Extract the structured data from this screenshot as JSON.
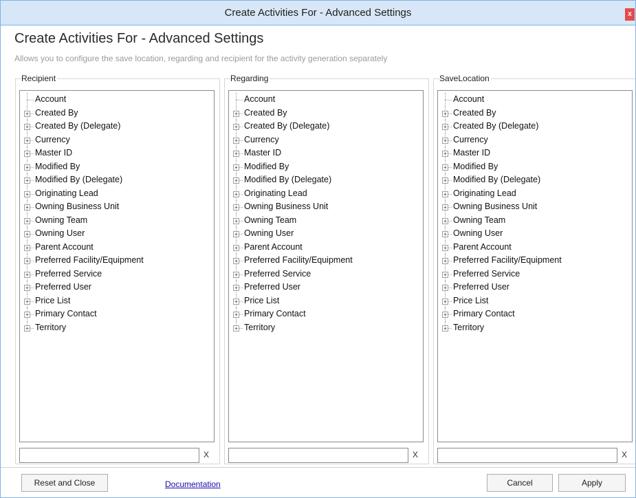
{
  "window": {
    "title": "Create Activities For - Advanced Settings",
    "close_label": "x"
  },
  "header": {
    "heading": "Create Activities For - Advanced Settings",
    "subheading": "Allows you to configure the save location, regarding and recipient for the activity generation separately"
  },
  "panels": [
    {
      "label": "Recipient",
      "items": [
        {
          "label": "Account",
          "expandable": false
        },
        {
          "label": "Created By",
          "expandable": true
        },
        {
          "label": "Created By (Delegate)",
          "expandable": true
        },
        {
          "label": "Currency",
          "expandable": true
        },
        {
          "label": "Master ID",
          "expandable": true
        },
        {
          "label": "Modified By",
          "expandable": true
        },
        {
          "label": "Modified By (Delegate)",
          "expandable": true
        },
        {
          "label": "Originating Lead",
          "expandable": true
        },
        {
          "label": "Owning Business Unit",
          "expandable": true
        },
        {
          "label": "Owning Team",
          "expandable": true
        },
        {
          "label": "Owning User",
          "expandable": true
        },
        {
          "label": "Parent Account",
          "expandable": true
        },
        {
          "label": "Preferred Facility/Equipment",
          "expandable": true
        },
        {
          "label": "Preferred Service",
          "expandable": true
        },
        {
          "label": "Preferred User",
          "expandable": true
        },
        {
          "label": "Price List",
          "expandable": true
        },
        {
          "label": "Primary Contact",
          "expandable": true
        },
        {
          "label": "Territory",
          "expandable": true
        }
      ],
      "filter_value": "",
      "clear_label": "X"
    },
    {
      "label": "Regarding",
      "items": [
        {
          "label": "Account",
          "expandable": false
        },
        {
          "label": "Created By",
          "expandable": true
        },
        {
          "label": "Created By (Delegate)",
          "expandable": true
        },
        {
          "label": "Currency",
          "expandable": true
        },
        {
          "label": "Master ID",
          "expandable": true
        },
        {
          "label": "Modified By",
          "expandable": true
        },
        {
          "label": "Modified By (Delegate)",
          "expandable": true
        },
        {
          "label": "Originating Lead",
          "expandable": true
        },
        {
          "label": "Owning Business Unit",
          "expandable": true
        },
        {
          "label": "Owning Team",
          "expandable": true
        },
        {
          "label": "Owning User",
          "expandable": true
        },
        {
          "label": "Parent Account",
          "expandable": true
        },
        {
          "label": "Preferred Facility/Equipment",
          "expandable": true
        },
        {
          "label": "Preferred Service",
          "expandable": true
        },
        {
          "label": "Preferred User",
          "expandable": true
        },
        {
          "label": "Price List",
          "expandable": true
        },
        {
          "label": "Primary Contact",
          "expandable": true
        },
        {
          "label": "Territory",
          "expandable": true
        }
      ],
      "filter_value": "",
      "clear_label": "X"
    },
    {
      "label": "SaveLocation",
      "items": [
        {
          "label": "Account",
          "expandable": false
        },
        {
          "label": "Created By",
          "expandable": true
        },
        {
          "label": "Created By (Delegate)",
          "expandable": true
        },
        {
          "label": "Currency",
          "expandable": true
        },
        {
          "label": "Master ID",
          "expandable": true
        },
        {
          "label": "Modified By",
          "expandable": true
        },
        {
          "label": "Modified By (Delegate)",
          "expandable": true
        },
        {
          "label": "Originating Lead",
          "expandable": true
        },
        {
          "label": "Owning Business Unit",
          "expandable": true
        },
        {
          "label": "Owning Team",
          "expandable": true
        },
        {
          "label": "Owning User",
          "expandable": true
        },
        {
          "label": "Parent Account",
          "expandable": true
        },
        {
          "label": "Preferred Facility/Equipment",
          "expandable": true
        },
        {
          "label": "Preferred Service",
          "expandable": true
        },
        {
          "label": "Preferred User",
          "expandable": true
        },
        {
          "label": "Price List",
          "expandable": true
        },
        {
          "label": "Primary Contact",
          "expandable": true
        },
        {
          "label": "Territory",
          "expandable": true
        }
      ],
      "filter_value": "",
      "clear_label": "X"
    }
  ],
  "footer": {
    "reset_label": "Reset and Close",
    "documentation_label": "Documentation",
    "cancel_label": "Cancel",
    "apply_label": "Apply"
  },
  "colors": {
    "titlebar_bg": "#d7e7f7",
    "window_border": "#7fb2e5",
    "close_button": "#e44b4b",
    "link": "#1a0dab"
  }
}
